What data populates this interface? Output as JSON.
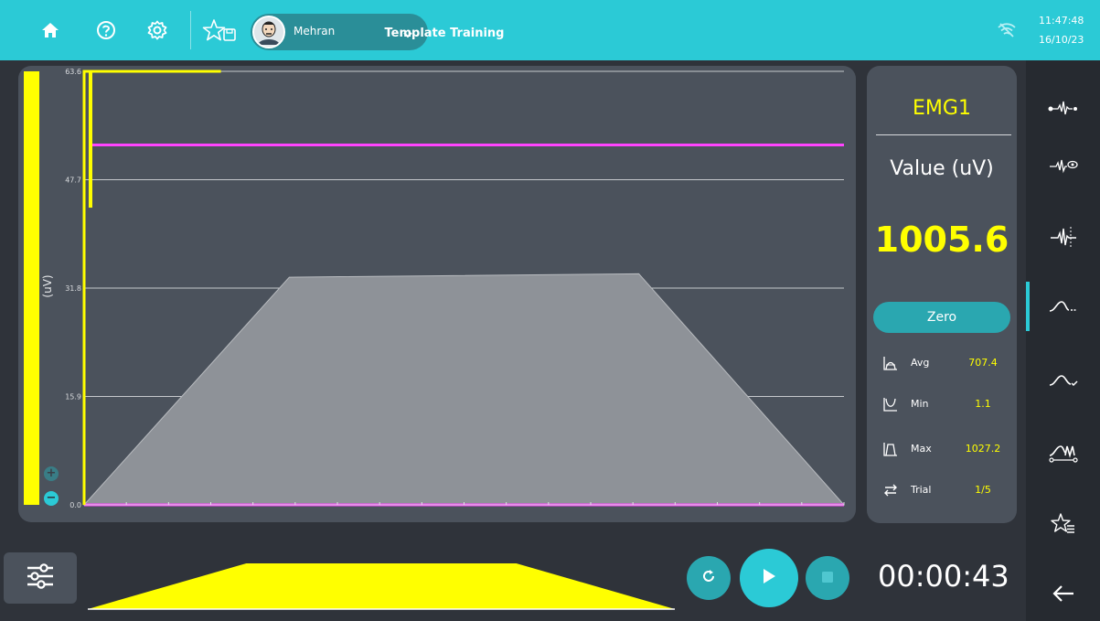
{
  "topbar": {
    "title": "Template Training",
    "user_name": "Mehran",
    "time": "11:47:48",
    "date": "16/10/23",
    "icons": [
      "home-icon",
      "help-icon",
      "settings-icon",
      "favorite-save-icon",
      "chevron-down-icon",
      "wifi-off-icon"
    ]
  },
  "chart": {
    "ylabel": "(uV)",
    "y_ticks": [
      "63.6",
      "47.7",
      "31.8",
      "15.9",
      "0.0"
    ],
    "zoom_in": "+",
    "zoom_out": "−"
  },
  "chart_data": {
    "type": "area",
    "ylabel": "(uV)",
    "ylim": [
      0,
      63.6
    ],
    "y_ticks": [
      0.0,
      15.9,
      31.8,
      47.7,
      63.6
    ],
    "xlim": [
      0,
      100
    ],
    "grid": true,
    "series": [
      {
        "role": "template",
        "color": "#9a9da3",
        "x": [
          0,
          27,
          73,
          100
        ],
        "y": [
          0,
          33.4,
          33.9,
          0
        ]
      },
      {
        "role": "threshold",
        "color": "#ff44ff",
        "x": [
          0.8,
          100
        ],
        "y": [
          52.8,
          52.8
        ]
      },
      {
        "role": "baseline",
        "color": "#ff44ff",
        "x": [
          0,
          100
        ],
        "y": [
          0,
          0
        ]
      },
      {
        "role": "signal",
        "color": "#ffff00",
        "x": [
          0,
          0,
          0.8,
          0.8,
          18
        ],
        "y": [
          0,
          63.6,
          63.6,
          63.6,
          63.6
        ]
      }
    ],
    "level_bar": {
      "color": "#ffff00",
      "fraction": 1.0
    },
    "x_ticks_count": 19
  },
  "stats": {
    "channel": "EMG1",
    "value_label": "Value (uV)",
    "value": "1005.6",
    "zero_label": "Zero",
    "rows": [
      {
        "icon": "avg-icon",
        "name": "Avg",
        "value": "707.4"
      },
      {
        "icon": "min-icon",
        "name": "Min",
        "value": "1.1"
      },
      {
        "icon": "max-icon",
        "name": "Max",
        "value": "1027.2"
      },
      {
        "icon": "trial-icon",
        "name": "Trial",
        "value": "1/5"
      }
    ]
  },
  "sidebar": {
    "items": [
      "raw-signal-icon",
      "signal-view-icon",
      "signal-marker-icon",
      "envelope-icon",
      "envelope-check-icon",
      "template-edit-icon",
      "favorites-list-icon",
      "back-arrow-icon"
    ],
    "active_index": 3
  },
  "bottom": {
    "timer": "00:00:43",
    "mini_template": {
      "color": "#ffff00",
      "x": [
        0,
        27,
        73,
        100
      ],
      "y": [
        0,
        1,
        1,
        0
      ]
    }
  },
  "colors": {
    "accent": "#2bcad6",
    "signal": "#ffff00",
    "threshold": "#ff44ff",
    "panel": "#4b525c",
    "background": "#2f333a"
  }
}
